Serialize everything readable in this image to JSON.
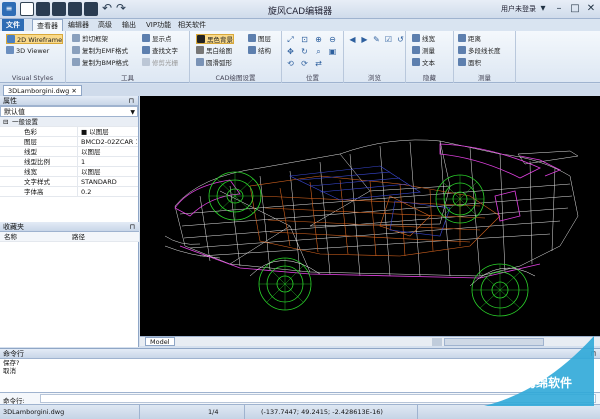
{
  "app": {
    "title": "旋风CAD编辑器",
    "user": "用户未登录"
  },
  "menu": [
    "文件",
    "查看器",
    "编辑器",
    "高级",
    "输出",
    "VIP功能",
    "相关软件"
  ],
  "ribbon": {
    "visual_styles": {
      "label": "Visual Styles",
      "items": [
        "2D Wireframe",
        "3D Viewer"
      ]
    },
    "tools": {
      "label": "工具",
      "col1": [
        "剪切框架",
        "复制为EMF格式",
        "复制为BMP格式"
      ],
      "col2": [
        "显示点",
        "查找文字",
        "修剪光栅"
      ]
    },
    "cad_settings": {
      "label": "CAD绘图设置",
      "col1": [
        "黑色背景",
        "黑白绘图",
        "圆滑弧形"
      ],
      "col2": [
        "图层",
        "结构"
      ]
    },
    "position": {
      "label": "位置"
    },
    "browse": {
      "label": "浏览"
    },
    "hide": {
      "label": "隐藏",
      "items": [
        "线宽",
        "测量",
        "文本"
      ]
    },
    "measure": {
      "label": "测量",
      "items": [
        "距离",
        "多段线长度",
        "面积"
      ]
    }
  },
  "doc_tab": "3DLamborgini.dwg",
  "properties": {
    "header": "属性",
    "combo": "默认值",
    "category": "一般设置",
    "rows": [
      {
        "k": "色彩",
        "v": "■ 以图层"
      },
      {
        "k": "图层",
        "v": "BMCD2-02ZCAR 19"
      },
      {
        "k": "线型",
        "v": "以图层"
      },
      {
        "k": "线型比例",
        "v": "1"
      },
      {
        "k": "线宽",
        "v": "以图层"
      },
      {
        "k": "文字样式",
        "v": "STANDARD"
      },
      {
        "k": "字体高",
        "v": "0.2"
      }
    ]
  },
  "favorites": {
    "header": "收藏夹",
    "col_name": "名称",
    "col_path": "路径"
  },
  "model_tab": "Model",
  "command": {
    "header": "命令行",
    "lines": [
      "保存?",
      "取消"
    ],
    "prompt_label": "命令行:"
  },
  "status": {
    "file": "3DLamborgini.dwg",
    "page": "1/4",
    "coords": "(-137.7447; 49.2415; -2.428613E-16)"
  },
  "watermark": "海绵软件",
  "colors": {
    "accent": "#2e6db5",
    "wheel": "#2bd62b",
    "body_magenta": "#e040e0",
    "frame_orange": "#d8651f"
  }
}
